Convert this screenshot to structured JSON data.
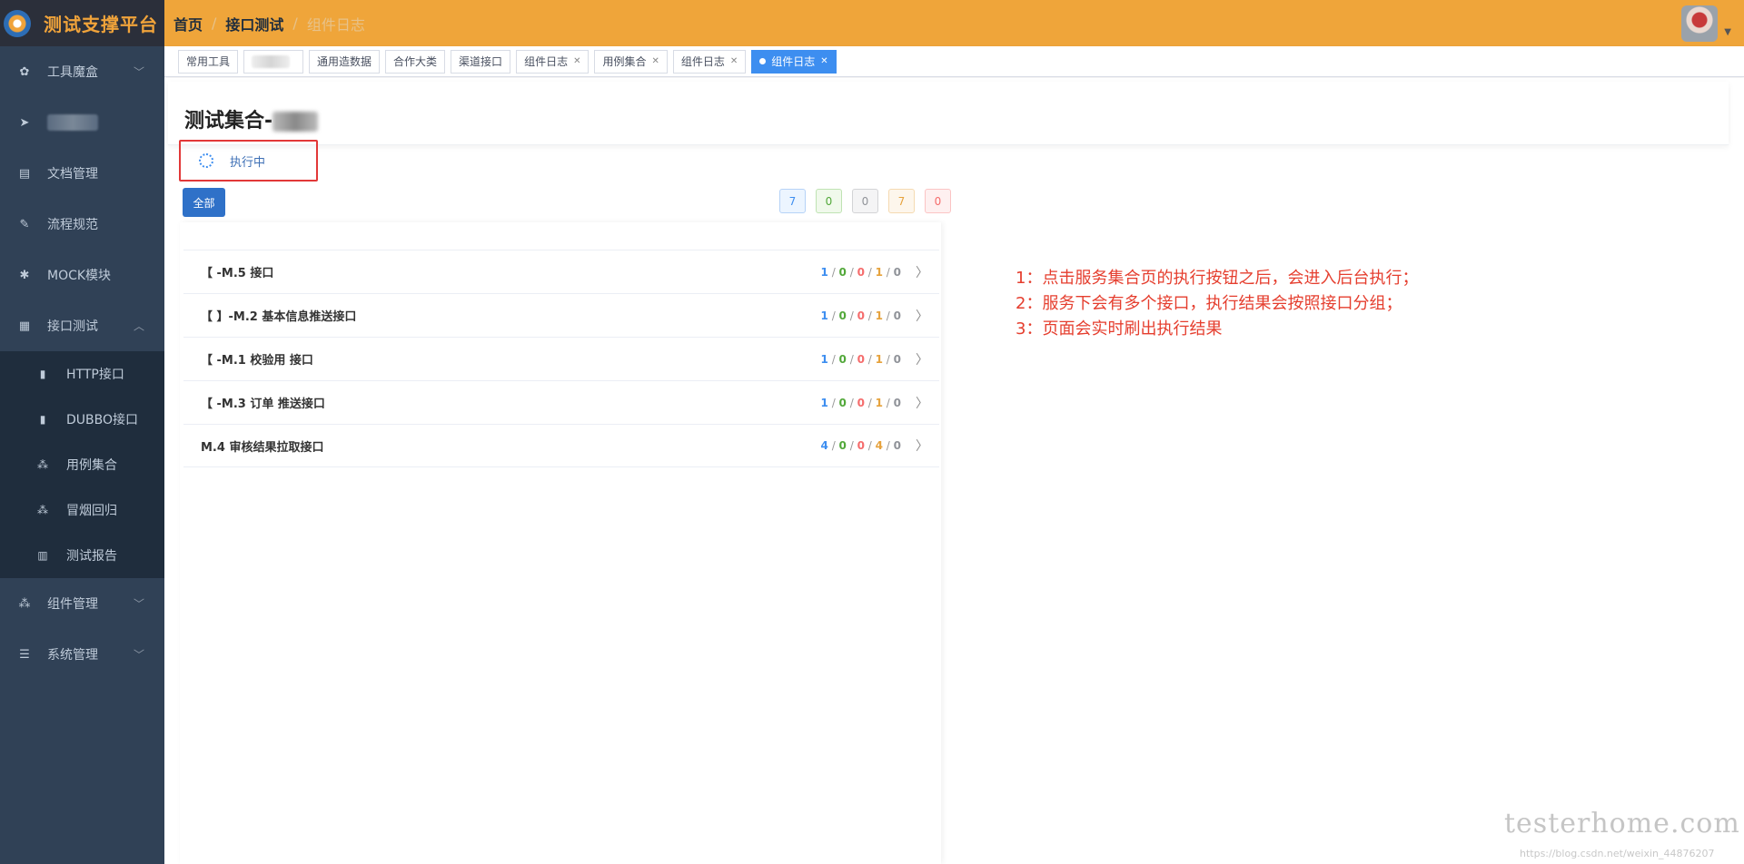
{
  "app": {
    "title": "测试支撑平台"
  },
  "header": {
    "breadcrumbs": [
      "首页",
      "接口测试",
      "组件日志"
    ],
    "separator": "/"
  },
  "sidebar": {
    "items": [
      {
        "label": "工具魔盒",
        "icon": "gear-icon",
        "arrow": "﹀"
      },
      {
        "label": "",
        "icon": "send-icon"
      },
      {
        "label": "文档管理",
        "icon": "document-icon"
      },
      {
        "label": "流程规范",
        "icon": "edit-icon"
      },
      {
        "label": "MOCK模块",
        "icon": "bug-icon"
      },
      {
        "label": "接口测试",
        "icon": "grid-icon",
        "arrow": "︿"
      }
    ],
    "subitems": [
      {
        "label": "HTTP接口",
        "icon": "info-icon"
      },
      {
        "label": "DUBBO接口",
        "icon": "info-icon"
      },
      {
        "label": "用例集合",
        "icon": "tree-icon"
      },
      {
        "label": "冒烟回归",
        "icon": "tree-icon"
      },
      {
        "label": "测试报告",
        "icon": "bar-chart-icon"
      }
    ],
    "bottom_items": [
      {
        "label": "组件管理",
        "icon": "tree-icon",
        "arrow": "﹀"
      },
      {
        "label": "系统管理",
        "icon": "list-icon",
        "arrow": "﹀"
      }
    ]
  },
  "tags": [
    {
      "label": "常用工具",
      "closable": false,
      "active": false
    },
    {
      "label": "",
      "closable": false,
      "active": false,
      "blurred": true
    },
    {
      "label": "通用造数据",
      "closable": false,
      "active": false
    },
    {
      "label": "合作大类",
      "closable": false,
      "active": false
    },
    {
      "label": "渠道接口",
      "closable": false,
      "active": false
    },
    {
      "label": "组件日志",
      "closable": true,
      "active": false
    },
    {
      "label": "用例集合",
      "closable": true,
      "active": false
    },
    {
      "label": "组件日志",
      "closable": true,
      "active": false
    },
    {
      "label": "组件日志",
      "closable": true,
      "active": true
    }
  ],
  "page": {
    "title": "测试集合-",
    "status": "执行中",
    "all_button": "全部",
    "counts": [
      {
        "value": "7",
        "color": "blue"
      },
      {
        "value": "0",
        "color": "green"
      },
      {
        "value": "0",
        "color": "gray"
      },
      {
        "value": "7",
        "color": "orange"
      },
      {
        "value": "0",
        "color": "red"
      }
    ],
    "rows": [
      {
        "name": "【 -M.5 接口",
        "stats": [
          "1",
          "0",
          "0",
          "1",
          "0"
        ]
      },
      {
        "name": "【 】-M.2 基本信息推送接口",
        "stats": [
          "1",
          "0",
          "0",
          "1",
          "0"
        ]
      },
      {
        "name": "【 -M.1 校验用 接口",
        "stats": [
          "1",
          "0",
          "0",
          "1",
          "0"
        ]
      },
      {
        "name": "【 -M.3 订单 推送接口",
        "stats": [
          "1",
          "0",
          "0",
          "1",
          "0"
        ]
      },
      {
        "name": "M.4 审核结果拉取接口",
        "stats": [
          "4",
          "0",
          "0",
          "4",
          "0"
        ]
      }
    ]
  },
  "notes": [
    "1：点击服务集合页的执行按钮之后，会进入后台执行；",
    "2：服务下会有多个接口，执行结果会按照接口分组；",
    "3：页面会实时刷出执行结果"
  ],
  "watermark": {
    "text": "testerhome.com",
    "url": "https://blog.csdn.net/weixin_44876207"
  },
  "colors": {
    "header": "#efa53a",
    "sidebar": "#304156",
    "accent": "#3d8ef0",
    "note": "#e53e2e"
  }
}
